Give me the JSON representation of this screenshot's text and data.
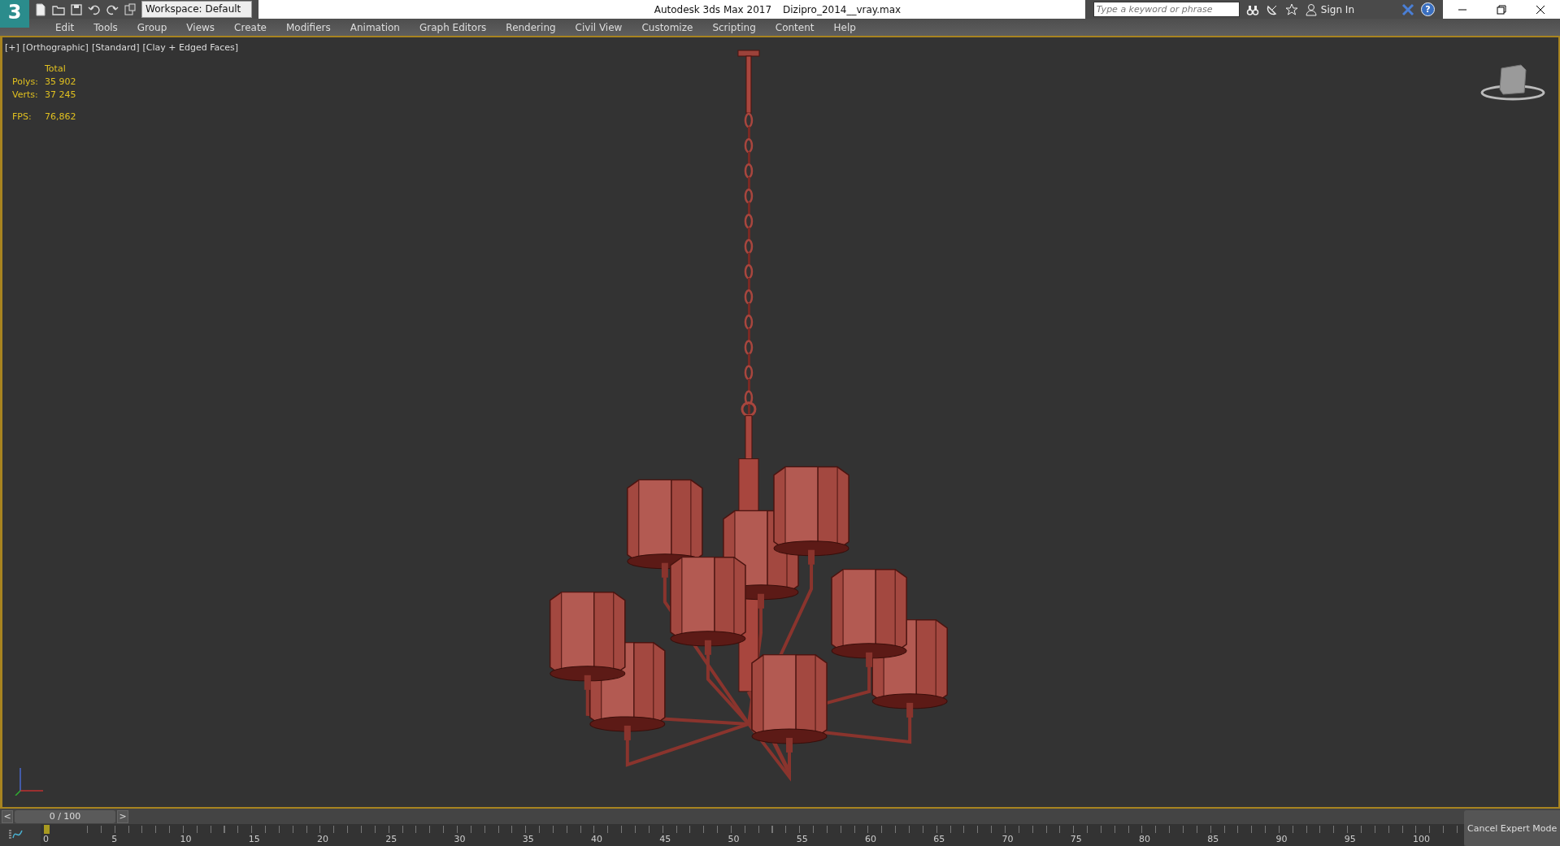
{
  "title_bar": {
    "logo_text": "3",
    "workspace": "Workspace: Default",
    "app_title": "Autodesk 3ds Max 2017",
    "file_name": "Dizipro_2014__vray.max",
    "search": {
      "placeholder": "Type a keyword or phrase"
    },
    "sign_in": "Sign In",
    "help": "?"
  },
  "menu": [
    "Edit",
    "Tools",
    "Group",
    "Views",
    "Create",
    "Modifiers",
    "Animation",
    "Graph Editors",
    "Rendering",
    "Civil View",
    "Customize",
    "Scripting",
    "Content",
    "Help"
  ],
  "viewport": {
    "labels": [
      "[+]",
      "[Orthographic]",
      "[Standard]",
      "[Clay + Edged Faces]"
    ],
    "stats": {
      "header": "Total",
      "rows": [
        {
          "label": "Polys:",
          "value": "35 902"
        },
        {
          "label": "Verts:",
          "value": "37 245"
        }
      ],
      "fps_label": "FPS:",
      "fps_value": "76,862"
    }
  },
  "time_slider": {
    "prev": "<",
    "position": "0 / 100",
    "next": ">",
    "level": 0
  },
  "ruler": [
    "0",
    "5",
    "10",
    "15",
    "20",
    "25",
    "30",
    "35",
    "40",
    "45",
    "50",
    "55",
    "60",
    "65",
    "70",
    "75",
    "80",
    "85",
    "90",
    "95",
    "100"
  ],
  "cancel_button": "Cancel Expert Mode"
}
